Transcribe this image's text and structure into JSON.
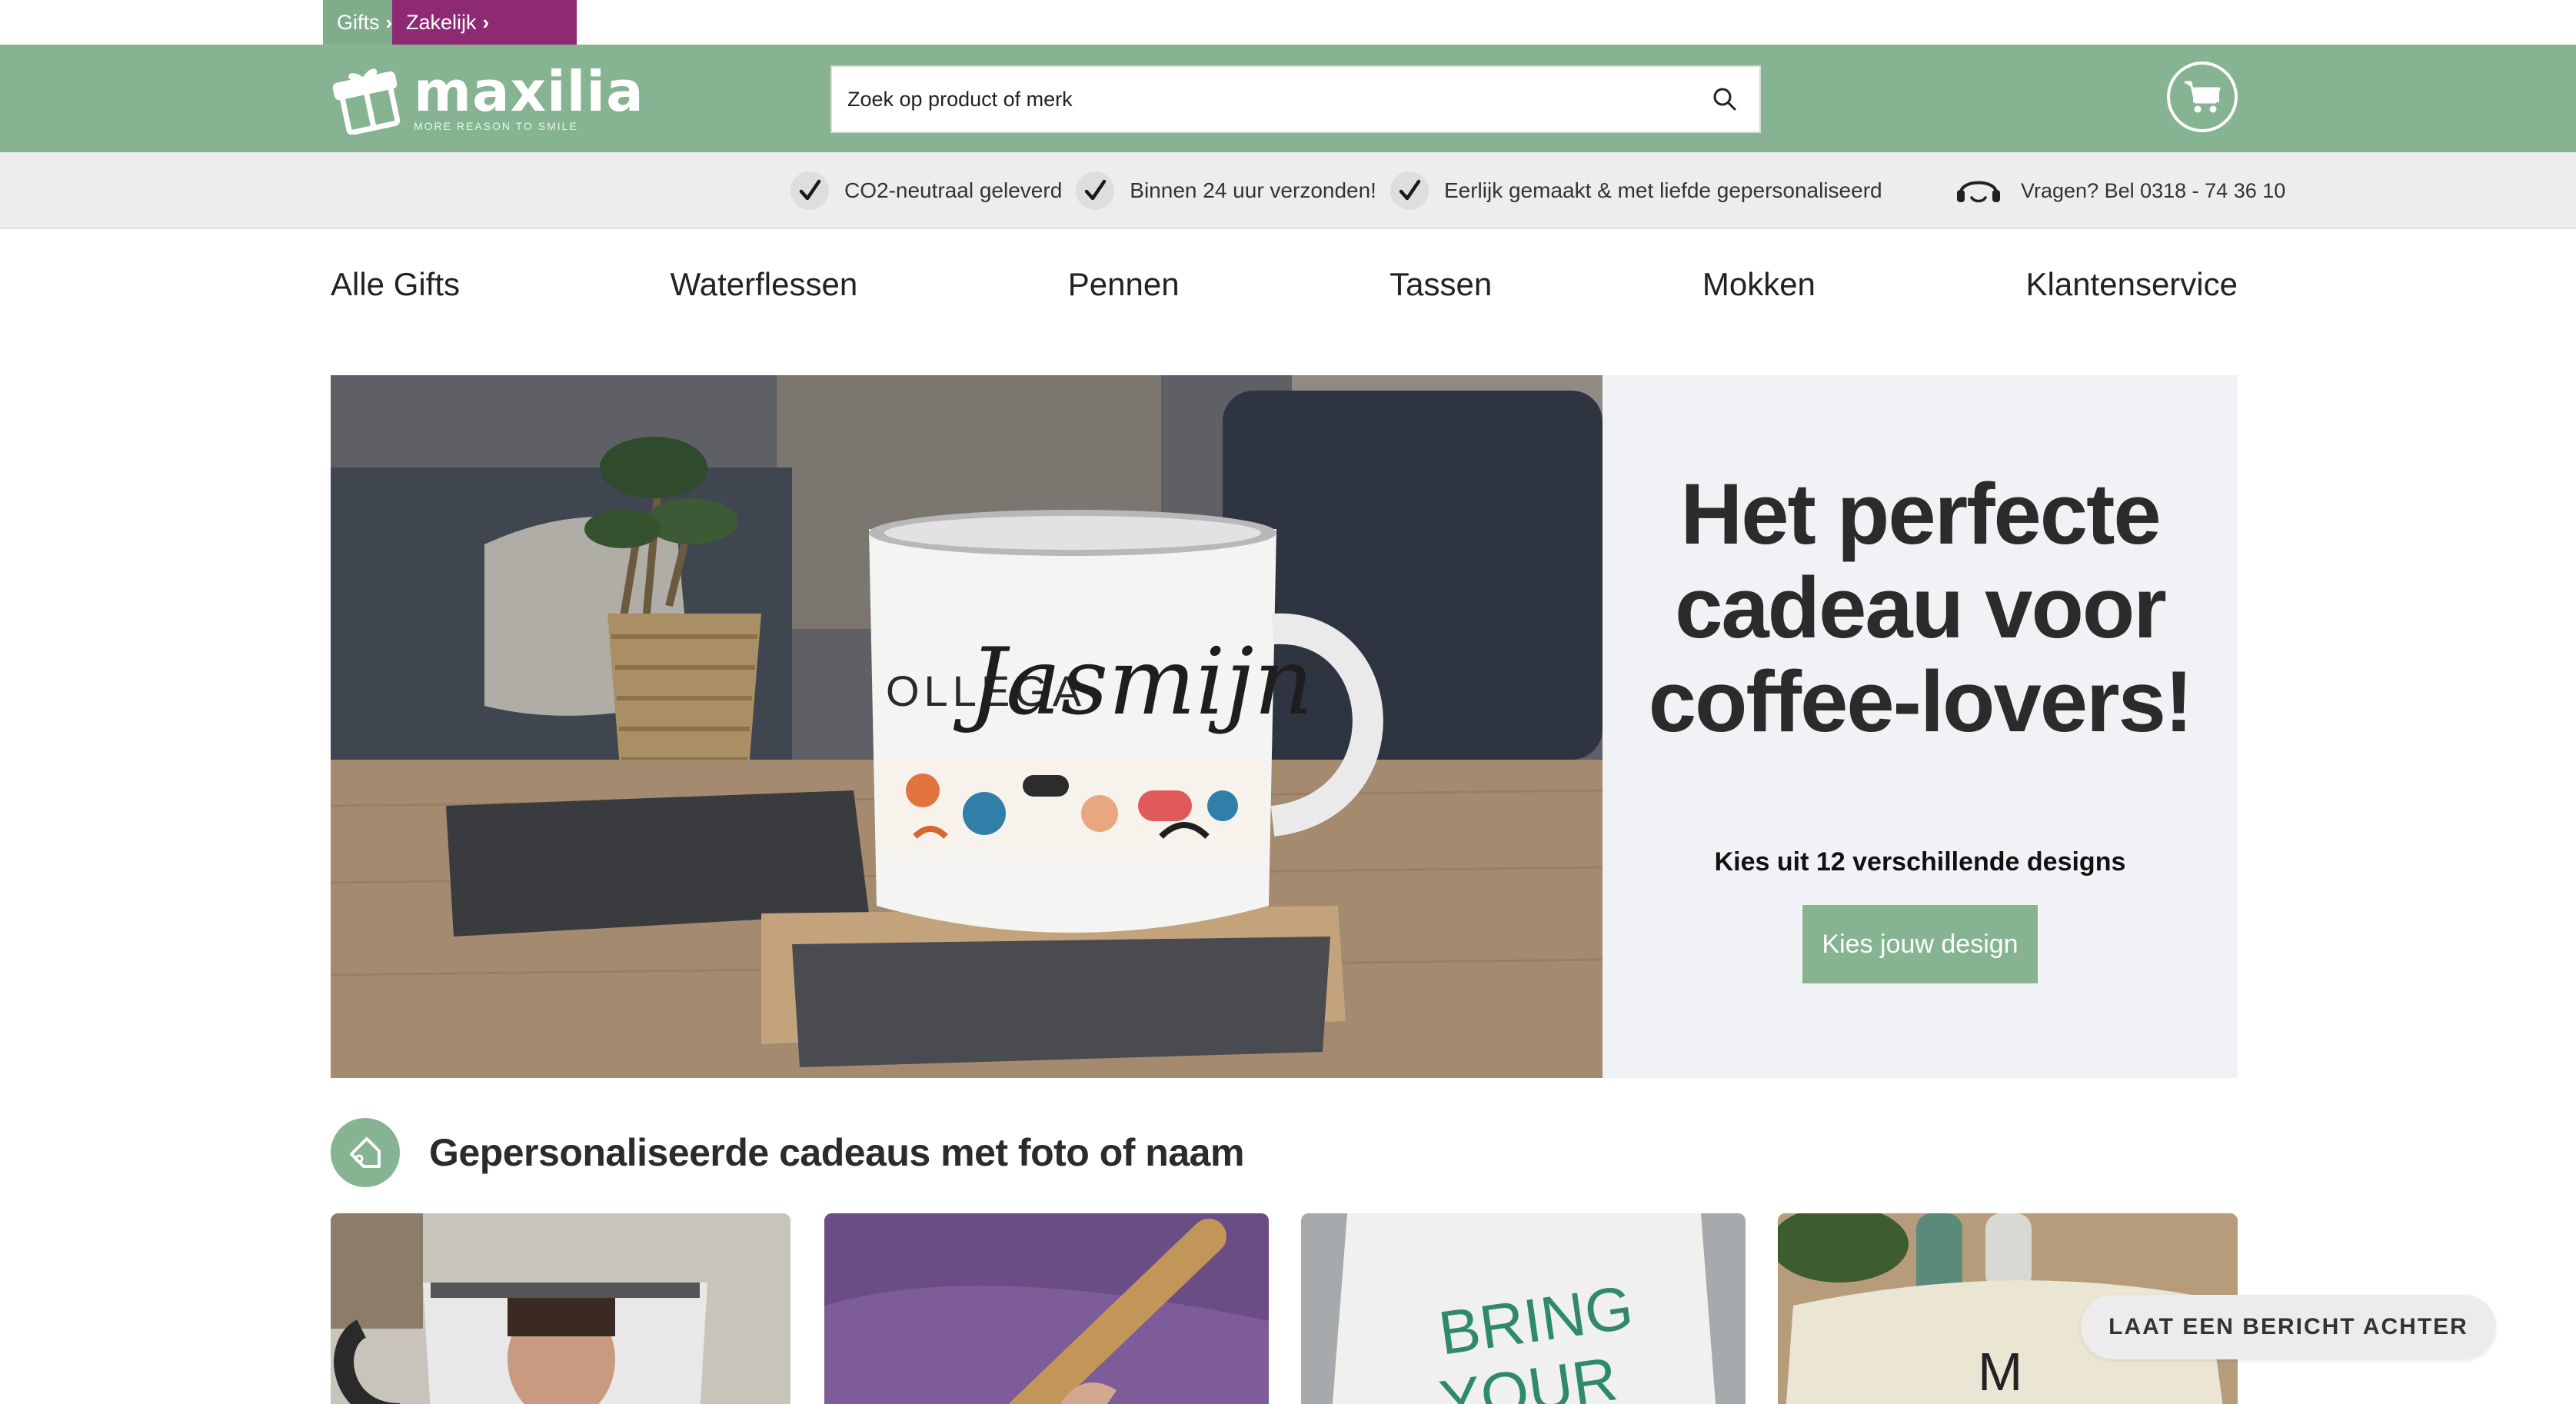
{
  "top_tabs": {
    "gifts": "Gifts",
    "zakelijk": "Zakelijk"
  },
  "header": {
    "logo_name": "maxilia",
    "logo_tagline": "MORE REASON TO SMILE",
    "search_placeholder": "Zoek op product of merk"
  },
  "usp": {
    "items": [
      "CO2-neutraal geleverd",
      "Binnen 24 uur verzonden!",
      "Eerlijk gemaakt & met liefde gepersonaliseerd"
    ],
    "phone": "Vragen? Bel 0318 - 74 36 10"
  },
  "nav": {
    "items": [
      "Alle Gifts",
      "Waterflessen",
      "Pennen",
      "Tassen",
      "Mokken",
      "Klantenservice"
    ]
  },
  "hero": {
    "title_line1": "Het perfecte",
    "title_line2": "cadeau voor",
    "title_line3": "coffee-lovers!",
    "subtitle": "Kies uit 12 verschillende designs",
    "button": "Kies jouw design",
    "mug_text_small": "OLLEGA",
    "mug_text_name": "Jasmijn"
  },
  "section": {
    "title": "Gepersonaliseerde cadeaus met foto of naam"
  },
  "cards": {
    "card3_text": "BRING",
    "card3_text2": "YOUR",
    "card4_text": "M"
  },
  "chat": {
    "label": "LAAT EEN BERICHT ACHTER"
  },
  "colors": {
    "brand_green": "#86b391",
    "brand_purple": "#8e2a73"
  }
}
